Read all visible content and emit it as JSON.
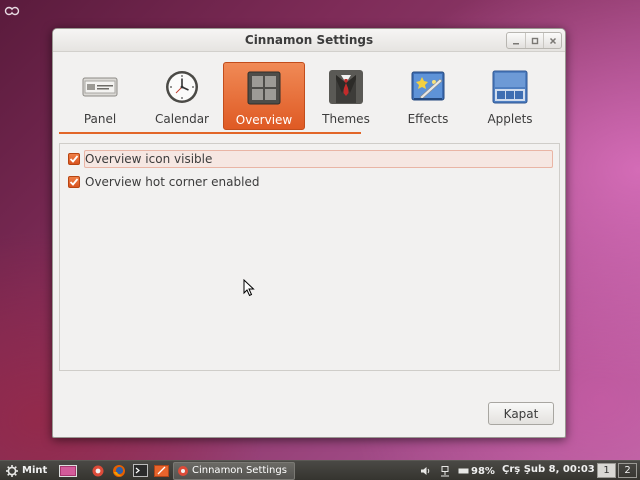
{
  "window": {
    "title": "Cinnamon Settings",
    "buttons": [
      "minimize-icon",
      "maximize-icon",
      "close-icon"
    ]
  },
  "toolbar": {
    "items": [
      {
        "label": "Panel",
        "icon": "panel-icon",
        "active": false
      },
      {
        "label": "Calendar",
        "icon": "clock-icon",
        "active": false
      },
      {
        "label": "Overview",
        "icon": "overview-grid-icon",
        "active": true
      },
      {
        "label": "Themes",
        "icon": "suit-tie-icon",
        "active": false
      },
      {
        "label": "Effects",
        "icon": "effects-icon",
        "active": false
      },
      {
        "label": "Applets",
        "icon": "applets-icon",
        "active": false
      }
    ]
  },
  "options": [
    {
      "label": "Overview icon visible",
      "checked": true,
      "focused": true
    },
    {
      "label": "Overview hot corner enabled",
      "checked": true,
      "focused": false
    }
  ],
  "close_button": "Kapat",
  "panel": {
    "menu_label": "Mint",
    "task_label": "Cinnamon Settings",
    "battery": "98%",
    "clock": "Çrş Şub  8, 00:03",
    "workspaces": [
      "1",
      "2"
    ],
    "active_workspace": "1"
  },
  "colors": {
    "accent": "#e26628",
    "window_bg": "#f2f1f0",
    "panel_bg": "#3c3b37"
  }
}
